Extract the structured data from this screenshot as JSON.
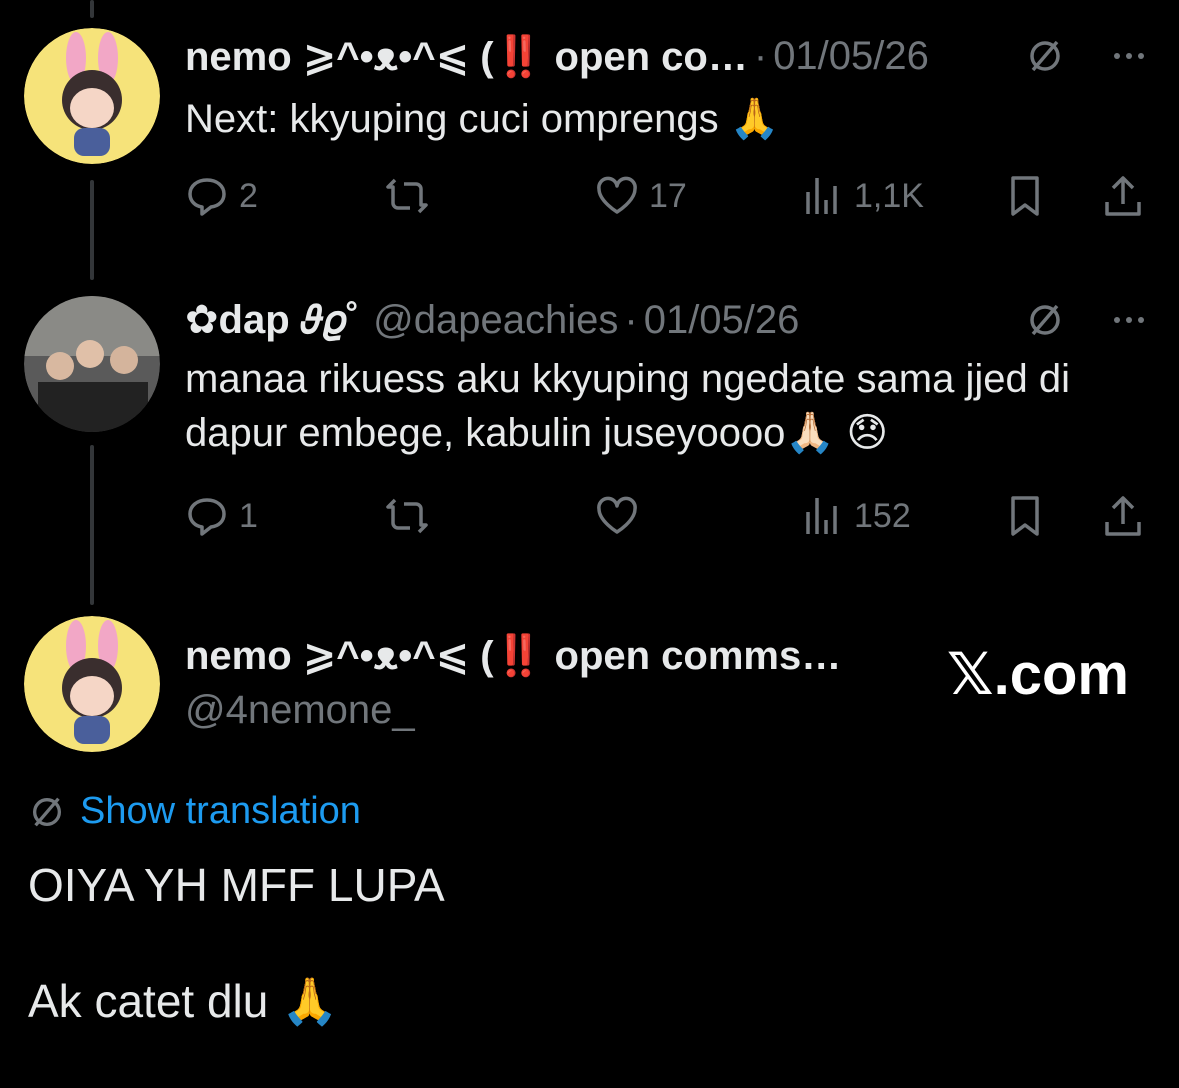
{
  "colors": {
    "background": "#000000",
    "text": "#e7e9ea",
    "muted": "#71767b",
    "link": "#1d9bf0",
    "thread_line": "#333639"
  },
  "tweet1": {
    "display_name": "nemo ⩾^•ᴥ•^⩽ (‼️ open co…",
    "separator": "·",
    "date": "01/05/26",
    "text": "Next: kkyuping cuci omprengs 🙏",
    "replies": "2",
    "likes": "17",
    "views": "1,1K",
    "icons": [
      "translate-icon",
      "more-icon",
      "reply-icon",
      "retweet-icon",
      "like-icon",
      "views-icon",
      "bookmark-icon",
      "share-icon"
    ]
  },
  "tweet2": {
    "display_name": "✿dap 𝜗𝜚˚",
    "handle": "@dapeachies",
    "separator": "·",
    "date": "01/05/26",
    "text": "manaa rikuess aku kkyuping ngedate sama jjed di dapur embege, kabulin juseyoooo🙏🏻 😞",
    "replies": "1",
    "views": "152"
  },
  "main": {
    "display_name": "nemo ⩾^•ᴥ•^⩽ (‼️ open comms…",
    "handle": "@4nemone_",
    "x_logo": "𝕏.com",
    "translation_label": "Show translation",
    "text": "OIYA YH MFF LUPA\n\nAk catet dlu 🙏"
  }
}
